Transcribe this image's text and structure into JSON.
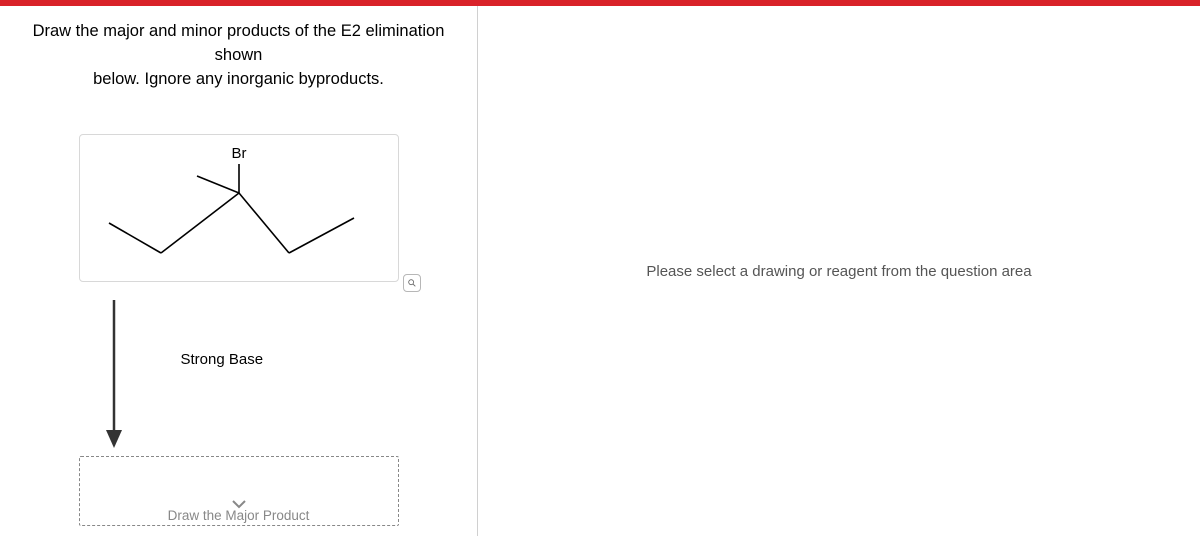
{
  "question": {
    "prompt_line1": "Draw the major and minor products of the E2 elimination shown",
    "prompt_line2": "below. Ignore any inorganic byproducts."
  },
  "molecule": {
    "substituent_label": "Br"
  },
  "reagent": {
    "label": "Strong Base"
  },
  "product_area": {
    "placeholder": "Draw the Major Product"
  },
  "right_panel": {
    "message": "Please select a drawing or reagent from the question area"
  }
}
